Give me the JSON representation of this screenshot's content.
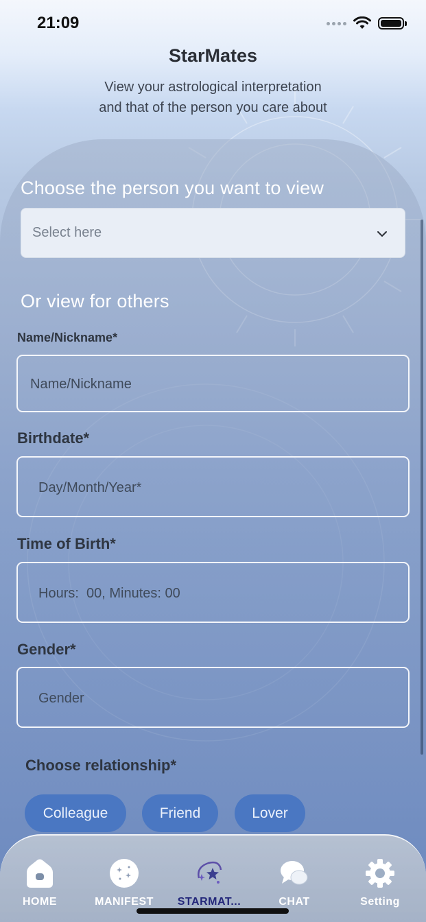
{
  "status_bar": {
    "time": "21:09"
  },
  "header": {
    "title": "StarMates",
    "subtitle_line1": "View your astrological interpretation",
    "subtitle_line2": "and that of the person you care about"
  },
  "choose_section": {
    "title": "Choose the person you want to view",
    "select_placeholder": "Select here"
  },
  "others_section": {
    "title": "Or view for others",
    "fields": [
      {
        "label": "Name/Nickname*",
        "placeholder": "Name/Nickname"
      },
      {
        "label": "Birthdate*",
        "placeholder": "Day/Month/Year*"
      },
      {
        "label": "Time of Birth*",
        "placeholder": "Hours:  00, Minutes: 00"
      },
      {
        "label": "Gender*",
        "placeholder": "Gender"
      }
    ]
  },
  "relationship": {
    "title": "Choose relationship*",
    "options": [
      "Colleague",
      "Friend",
      "Lover"
    ]
  },
  "tabs": [
    {
      "label": "HOME",
      "icon": "home-icon"
    },
    {
      "label": "MANIFEST",
      "icon": "sparkle-orb-icon"
    },
    {
      "label": "STARMAT...",
      "icon": "stars-orbit-icon",
      "active": true
    },
    {
      "label": "CHAT",
      "icon": "chat-bubbles-icon"
    },
    {
      "label": "Setting",
      "icon": "gear-icon"
    }
  ],
  "colors": {
    "chip": "#4a77c2",
    "active_tab": "#23277a"
  }
}
